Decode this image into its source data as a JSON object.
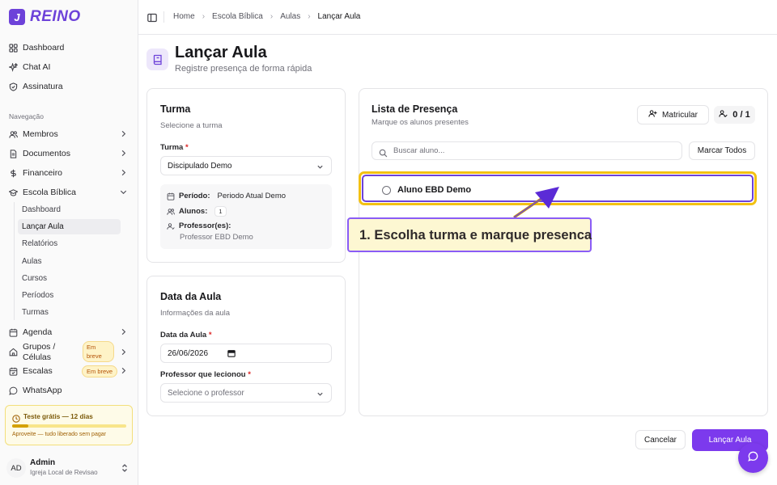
{
  "brand": {
    "name": "REINO",
    "mark": "J",
    "accent": "#6d42d9"
  },
  "sidebar": {
    "top_items": [
      {
        "label": "Dashboard",
        "icon": "grid-icon"
      },
      {
        "label": "Chat AI",
        "icon": "sparkles-icon"
      },
      {
        "label": "Assinatura",
        "icon": "shield-check-icon"
      }
    ],
    "section_label": "Navegação",
    "nav_items": [
      {
        "label": "Membros",
        "icon": "users-icon"
      },
      {
        "label": "Documentos",
        "icon": "file-icon"
      },
      {
        "label": "Financeiro",
        "icon": "dollar-icon"
      },
      {
        "label": "Escola Bíblica",
        "icon": "graduation-cap-icon"
      }
    ],
    "school_sub_items": [
      "Dashboard",
      "Lançar Aula",
      "Relatórios",
      "Aulas",
      "Cursos",
      "Períodos",
      "Turmas"
    ],
    "more_items": [
      {
        "label": "Agenda",
        "icon": "calendar-icon"
      },
      {
        "label": "Grupos / Células",
        "icon": "home-icon",
        "badge": "Em breve"
      },
      {
        "label": "Escalas",
        "icon": "calendar-check-icon",
        "badge": "Em breve"
      },
      {
        "label": "WhatsApp",
        "icon": "message-circle-icon"
      }
    ],
    "trial": {
      "title": "Teste grátis — 12 dias",
      "note": "Aproveite — tudo liberado sem pagar",
      "progress": 0.14
    },
    "user": {
      "initials": "AD",
      "name": "Admin",
      "org": "Igreja Local de Revisao"
    }
  },
  "header": {
    "breadcrumbs": [
      "Home",
      "Escola Bíblica",
      "Aulas",
      "Lançar Aula"
    ]
  },
  "page": {
    "title": "Lançar Aula",
    "subtitle": "Registre presença de forma rápida"
  },
  "turma_card": {
    "title": "Turma",
    "desc": "Selecione a turma",
    "field_label": "Turma",
    "required_mark": "*",
    "selected": "Discipulado Demo",
    "info": {
      "periodo_label": "Período:",
      "periodo_value": "Periodo Atual Demo",
      "alunos_label": "Alunos:",
      "alunos_value": "1",
      "professor_label": "Professor(es):",
      "professor_value": "Professor EBD Demo"
    }
  },
  "data_card": {
    "title": "Data da Aula",
    "desc": "Informações da aula",
    "date_label": "Data da Aula",
    "date_value": "26/06/2026",
    "prof_label": "Professor que lecionou",
    "prof_placeholder": "Selecione o professor",
    "required_mark": "*"
  },
  "presenca": {
    "title": "Lista de Presença",
    "desc": "Marque os alunos presentes",
    "matricular": "Matricular",
    "counter": "0 / 1",
    "search_placeholder": "Buscar aluno...",
    "mark_all": "Marcar Todos",
    "students": [
      "Aluno EBD Demo"
    ]
  },
  "callout": {
    "text": "1. Escolha turma e marque presenca"
  },
  "actions": {
    "cancel": "Cancelar",
    "submit": "Lançar Aula"
  }
}
